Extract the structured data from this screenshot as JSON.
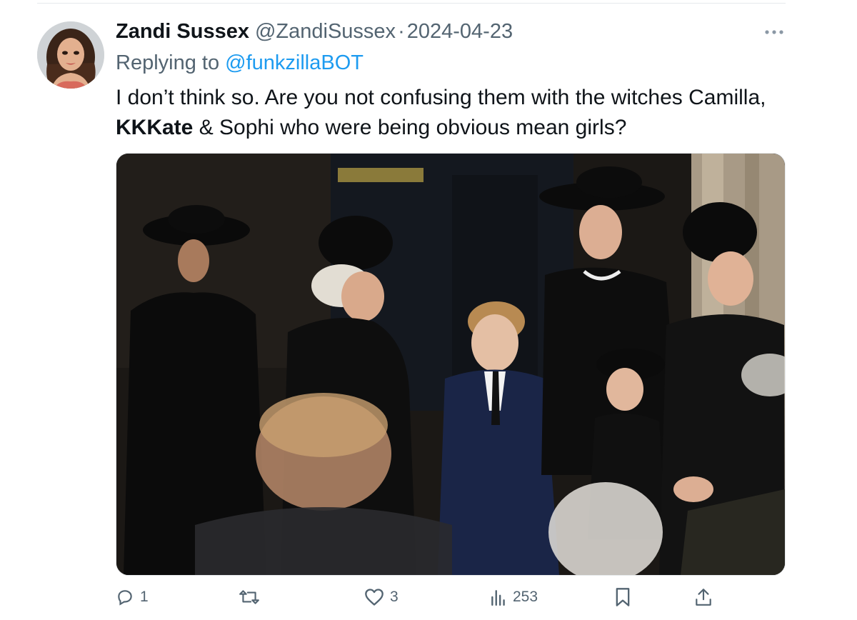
{
  "tweet": {
    "display_name": "Zandi Sussex",
    "handle": "@ZandiSussex",
    "separator": "·",
    "date": "2024-04-23",
    "more_icon": "more-horizontal-icon",
    "replying_prefix": "Replying to",
    "replying_handle": "@funkzillaBOT",
    "text_line1": "I don’t think so. Are you not confusing them with the witches Camilla,",
    "text_bold": "KKKate",
    "text_line2_rest": " & Sophi who were being obvious mean girls?",
    "media_icon": "photo",
    "colors": {
      "link": "#1d9bf0",
      "secondary": "#536471",
      "primary": "#0f1419"
    }
  },
  "actions": {
    "reply": {
      "icon": "reply-icon",
      "count": "1"
    },
    "retweet": {
      "icon": "retweet-icon",
      "count": ""
    },
    "like": {
      "icon": "like-icon",
      "count": "3"
    },
    "views": {
      "icon": "views-icon",
      "count": "253"
    },
    "bookmark": {
      "icon": "bookmark-icon",
      "count": ""
    },
    "share": {
      "icon": "share-icon",
      "count": ""
    }
  }
}
